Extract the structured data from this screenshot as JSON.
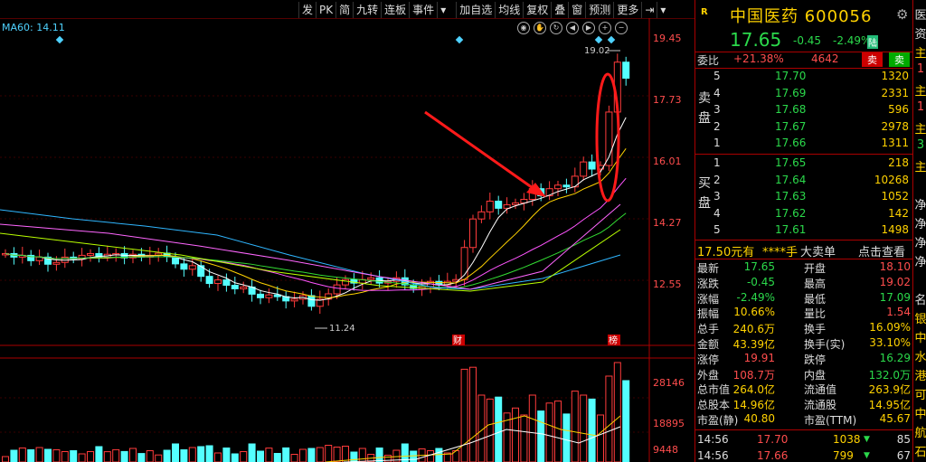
{
  "toolbar": {
    "left_buttons": [
      "发",
      "PK",
      "简",
      "九转",
      "连板",
      "事件"
    ],
    "right_buttons": [
      "加自选",
      "均线",
      "复权",
      "叠",
      "窗",
      "预测",
      "更多"
    ]
  },
  "chart": {
    "ma_label": "MA60: 14.11",
    "price_axis": [
      "19.45",
      "17.73",
      "16.01",
      "14.27",
      "12.55"
    ],
    "high_marker": "19.02",
    "low_marker": "11.24",
    "events": [
      "财",
      "榜"
    ],
    "volume_axis": [
      "28146",
      "18895",
      "9448"
    ]
  },
  "stock": {
    "badge": "R",
    "name": "中国医药",
    "code": "600056",
    "price": "17.65",
    "change": "-0.45",
    "change_pct": "-2.49%",
    "exchange_tag": "陆"
  },
  "weibi": {
    "label": "委比",
    "ratio": "+21.38%",
    "diff": "4642",
    "sell_label": "卖",
    "buy_label": "卖"
  },
  "orderbook": {
    "sell_side_label": [
      "卖",
      "盘"
    ],
    "buy_side_label": [
      "买",
      "盘"
    ],
    "sells": [
      {
        "level": "5",
        "price": "17.70",
        "vol": "1320"
      },
      {
        "level": "4",
        "price": "17.69",
        "vol": "2331"
      },
      {
        "level": "3",
        "price": "17.68",
        "vol": "596"
      },
      {
        "level": "2",
        "price": "17.67",
        "vol": "2978"
      },
      {
        "level": "1",
        "price": "17.66",
        "vol": "1311"
      }
    ],
    "buys": [
      {
        "level": "1",
        "price": "17.65",
        "vol": "218"
      },
      {
        "level": "2",
        "price": "17.64",
        "vol": "10268"
      },
      {
        "level": "3",
        "price": "17.63",
        "vol": "1052"
      },
      {
        "level": "4",
        "price": "17.62",
        "vol": "142"
      },
      {
        "level": "5",
        "price": "17.61",
        "vol": "1498"
      }
    ]
  },
  "big_deal": {
    "price": "17.50元有",
    "hands": "****手",
    "type": "大卖单",
    "link": "点击查看"
  },
  "quote": [
    {
      "l": "最新",
      "v": "17.65",
      "vc": "#2bd94b",
      "l2": "开盘",
      "v2": "18.10",
      "v2c": "#ff4d4d"
    },
    {
      "l": "涨跌",
      "v": "-0.45",
      "vc": "#2bd94b",
      "l2": "最高",
      "v2": "19.02",
      "v2c": "#ff4d4d"
    },
    {
      "l": "涨幅",
      "v": "-2.49%",
      "vc": "#2bd94b",
      "l2": "最低",
      "v2": "17.09",
      "v2c": "#2bd94b"
    },
    {
      "l": "振幅",
      "v": "10.66%",
      "vc": "#ffd200",
      "l2": "量比",
      "v2": "1.54",
      "v2c": "#ff4d4d"
    },
    {
      "l": "总手",
      "v": "240.6万",
      "vc": "#ffd200",
      "l2": "换手",
      "v2": "16.09%",
      "v2c": "#ffd200"
    },
    {
      "l": "金额",
      "v": "43.39亿",
      "vc": "#ffd200",
      "l2": "换手(实)",
      "v2": "33.10%",
      "v2c": "#ffd200"
    },
    {
      "l": "涨停",
      "v": "19.91",
      "vc": "#ff4d4d",
      "l2": "跌停",
      "v2": "16.29",
      "v2c": "#2bd94b"
    },
    {
      "l": "外盘",
      "v": "108.7万",
      "vc": "#ff4d4d",
      "l2": "内盘",
      "v2": "132.0万",
      "v2c": "#2bd94b"
    },
    {
      "l": "总市值",
      "v": "264.0亿",
      "vc": "#ffd200",
      "l2": "流通值",
      "v2": "263.9亿",
      "v2c": "#ffd200"
    },
    {
      "l": "总股本",
      "v": "14.96亿",
      "vc": "#ffd200",
      "l2": "流通股",
      "v2": "14.95亿",
      "v2c": "#ffd200"
    },
    {
      "l": "市盈(静)",
      "v": "40.80",
      "vc": "#ffd200",
      "l2": "市盈(TTM)",
      "v2": "45.67",
      "v2c": "#ffd200"
    }
  ],
  "ticks": [
    {
      "time": "14:56",
      "price": "17.70",
      "vol": "1038",
      "dir": "down",
      "n": "85"
    },
    {
      "time": "14:56",
      "price": "17.66",
      "vol": "799",
      "dir": "down",
      "n": "67"
    }
  ],
  "side_strip": [
    "医",
    "资",
    "主",
    "1",
    "主",
    "1",
    "主",
    "3",
    "主",
    "",
    "净",
    "净",
    "净",
    "净",
    "",
    "名",
    "银",
    "中",
    "水",
    "港",
    "可",
    "中",
    "航",
    "石"
  ],
  "colors": {
    "up": "#ff4d4d",
    "down": "#2bd94b",
    "accent": "#ffd200",
    "annotation": "#ff1a1a"
  }
}
